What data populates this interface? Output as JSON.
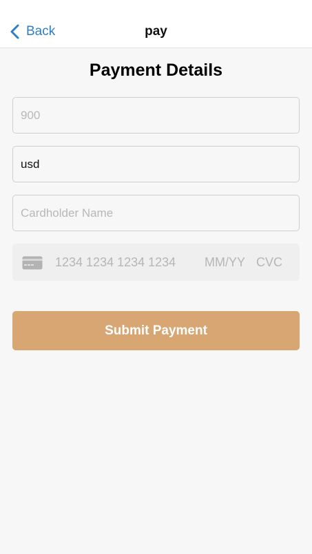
{
  "nav": {
    "back_label": "Back",
    "title": "pay"
  },
  "page": {
    "title": "Payment Details"
  },
  "form": {
    "amount": {
      "value": "",
      "placeholder": "900"
    },
    "currency": {
      "value": "usd",
      "placeholder": ""
    },
    "cardholder": {
      "value": "",
      "placeholder": "Cardholder Name"
    },
    "card": {
      "icon": "credit-card-icon",
      "number_placeholder": "1234 1234 1234 1234",
      "expiry_placeholder": "MM/YY",
      "cvc_placeholder": "CVC"
    },
    "submit_label": "Submit Payment"
  },
  "colors": {
    "accent": "#2c7fc4",
    "submit": "#d8a672",
    "background": "#f7f7f7"
  }
}
